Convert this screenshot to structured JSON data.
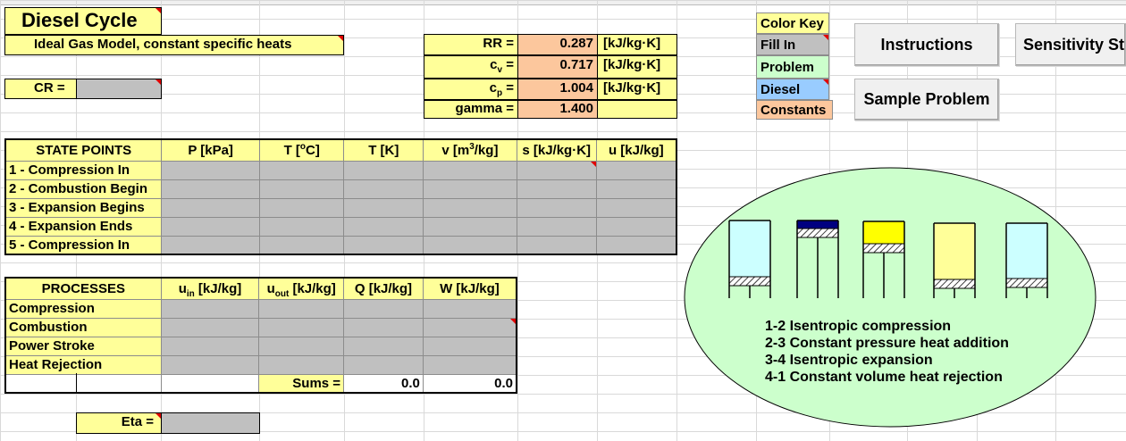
{
  "title": "Diesel Cycle",
  "subtitle": "Ideal Gas Model, constant specific heats",
  "cr_label": "CR =",
  "constants": [
    {
      "label": "RR =",
      "value": "0.287",
      "unit": "[kJ/kg·K]"
    },
    {
      "label": "cv =",
      "value": "0.717",
      "unit": "[kJ/kg·K]"
    },
    {
      "label": "cp =",
      "value": "1.004",
      "unit": "[kJ/kg·K]"
    },
    {
      "label": "gamma =",
      "value": "1.400",
      "unit": ""
    }
  ],
  "color_key": {
    "title": "Color Key",
    "items": [
      {
        "label": "Fill In",
        "color": "#c0c0c0"
      },
      {
        "label": "Problem",
        "color": "#ccffcc"
      },
      {
        "label": "Diesel",
        "color": "#99ccff"
      },
      {
        "label": "Constants",
        "color": "#fcc79d"
      }
    ]
  },
  "buttons": {
    "instructions": "Instructions",
    "sensitivity": "Sensitivity St",
    "sample": "Sample Problem"
  },
  "state_table": {
    "headers": [
      "STATE POINTS",
      "P [kPa]",
      "T [°C]",
      "T [K]",
      "v [m³/kg]",
      "s [kJ/kg·K]",
      "u [kJ/kg]"
    ],
    "rows": [
      "1 - Compression In",
      "2 - Combustion Begin",
      "3 - Expansion Begins",
      "4 - Expansion Ends",
      "5 - Compression In"
    ]
  },
  "process_table": {
    "headers": [
      "PROCESSES",
      "uin [kJ/kg]",
      "uout [kJ/kg]",
      "Q [kJ/kg]",
      "W [kJ/kg]"
    ],
    "rows": [
      "Compression",
      "Combustion",
      "Power Stroke",
      "Heat Rejection"
    ],
    "sums_label": "Sums =",
    "sum_q": "0.0",
    "sum_w": "0.0"
  },
  "eta_label": "Eta =",
  "diagram": {
    "legend": [
      "1-2 Isentropic compression",
      "2-3 Constant pressure heat addition",
      "3-4 Isentropic expansion",
      "4-1 Constant volume heat rejection"
    ],
    "colors": {
      "air": "#ccffff",
      "fuel": "#000080",
      "hot": "#ffff00",
      "expand": "#ffff99",
      "oval": "#ccffcc"
    }
  }
}
